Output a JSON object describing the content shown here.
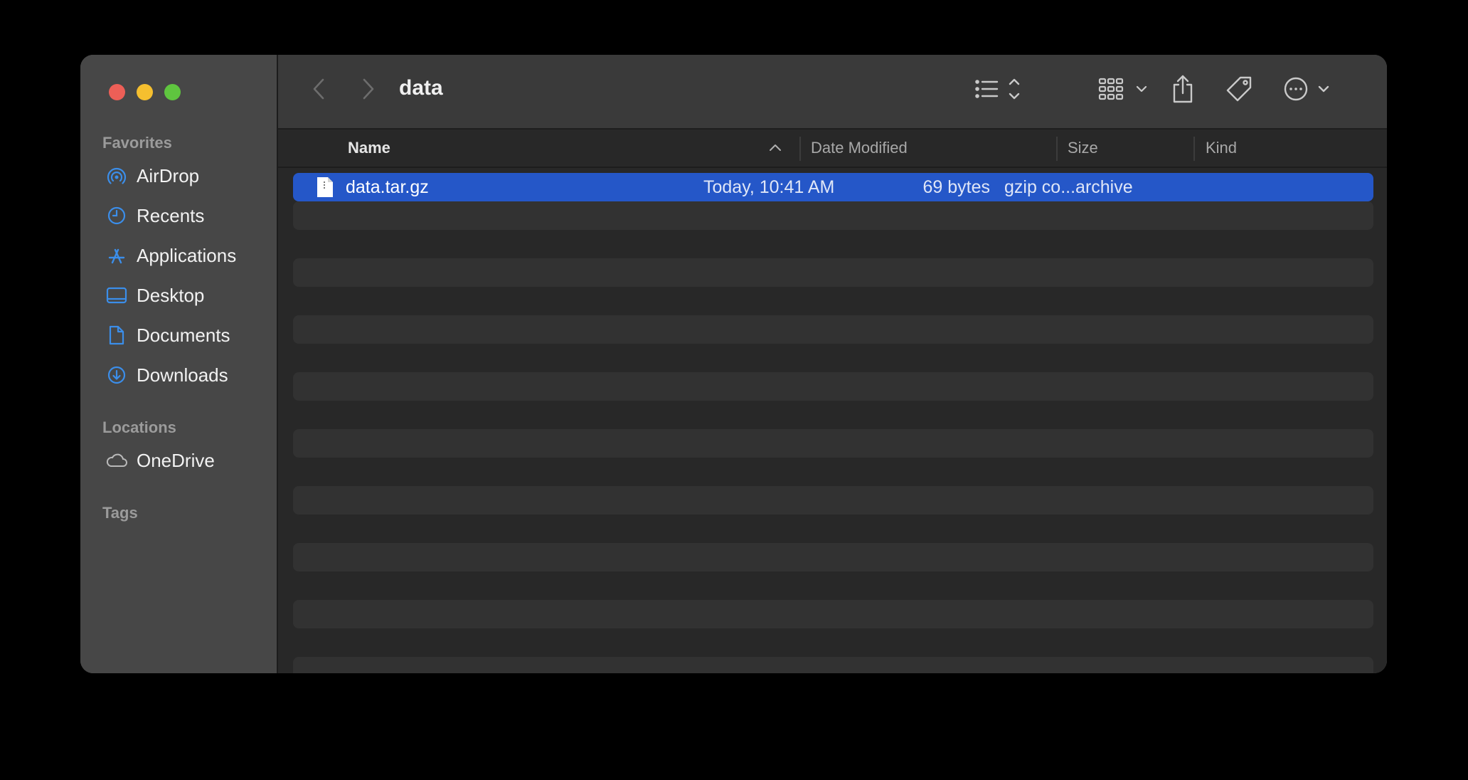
{
  "window": {
    "title": "data"
  },
  "sidebar": {
    "favorites_label": "Favorites",
    "favorites": [
      {
        "label": "AirDrop",
        "icon": "airdrop-icon"
      },
      {
        "label": "Recents",
        "icon": "clock-icon"
      },
      {
        "label": "Applications",
        "icon": "applications-icon"
      },
      {
        "label": "Desktop",
        "icon": "desktop-icon"
      },
      {
        "label": "Documents",
        "icon": "document-icon"
      },
      {
        "label": "Downloads",
        "icon": "download-icon"
      }
    ],
    "locations_label": "Locations",
    "locations": [
      {
        "label": "OneDrive",
        "icon": "cloud-icon"
      }
    ],
    "tags_label": "Tags"
  },
  "columns": {
    "name": "Name",
    "date_modified": "Date Modified",
    "size": "Size",
    "kind": "Kind"
  },
  "files": [
    {
      "name": "data.tar.gz",
      "date_modified": "Today, 10:41 AM",
      "size": "69 bytes",
      "kind": "gzip co...archive",
      "selected": true
    }
  ],
  "colors": {
    "accent": "#2557c8",
    "sidebar_icon": "#3b8eea",
    "close": "#ed5f57",
    "minimize": "#f5bf2f",
    "maximize": "#5fc53f"
  }
}
